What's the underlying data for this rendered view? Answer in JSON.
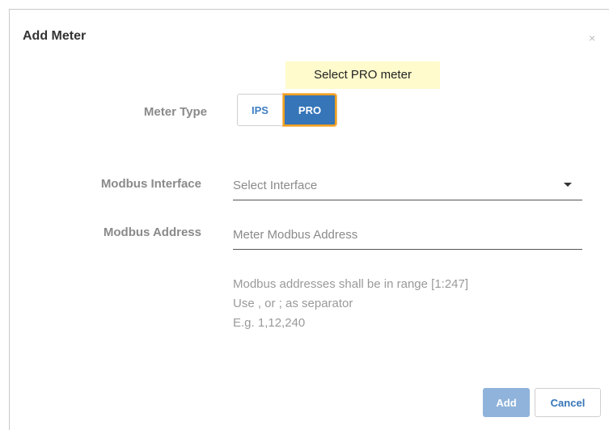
{
  "dialog": {
    "title": "Add Meter",
    "close_glyph": "×"
  },
  "tooltip": {
    "text": "Select PRO meter"
  },
  "meter_type": {
    "label": "Meter Type",
    "options": [
      "IPS",
      "PRO"
    ],
    "selected": "PRO"
  },
  "modbus_interface": {
    "label": "Modbus Interface",
    "placeholder": "Select Interface",
    "icon": "chevron-down-icon"
  },
  "modbus_address": {
    "label": "Modbus Address",
    "placeholder": "Meter Modbus Address",
    "value": ""
  },
  "help": {
    "lines": [
      "Modbus addresses shall be in range [1:247]",
      "Use , or ; as separator",
      "E.g. 1,12,240"
    ]
  },
  "buttons": {
    "add_label": "Add",
    "cancel_label": "Cancel"
  },
  "colors": {
    "primary": "#3575b8",
    "primary_disabled": "#8fb3db",
    "highlight_border": "#f0a020",
    "tooltip_bg": "#fffbcc"
  }
}
